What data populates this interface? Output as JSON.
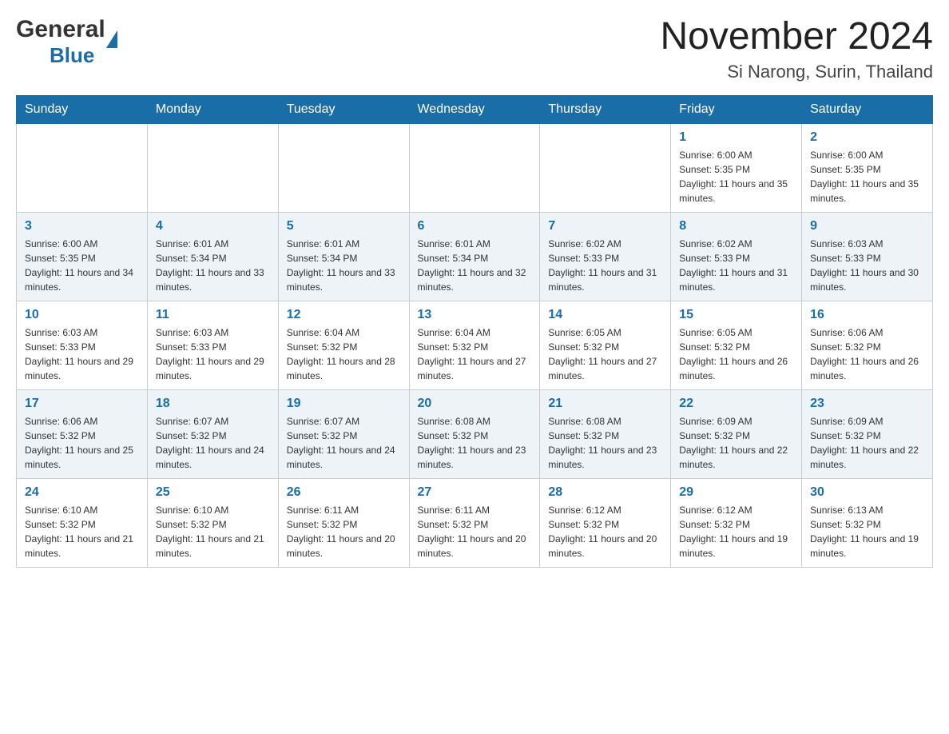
{
  "header": {
    "logo_line1": "General",
    "logo_line2": "Blue",
    "month_title": "November 2024",
    "location": "Si Narong, Surin, Thailand"
  },
  "days_of_week": [
    "Sunday",
    "Monday",
    "Tuesday",
    "Wednesday",
    "Thursday",
    "Friday",
    "Saturday"
  ],
  "weeks": [
    [
      {
        "day": "",
        "info": ""
      },
      {
        "day": "",
        "info": ""
      },
      {
        "day": "",
        "info": ""
      },
      {
        "day": "",
        "info": ""
      },
      {
        "day": "",
        "info": ""
      },
      {
        "day": "1",
        "info": "Sunrise: 6:00 AM\nSunset: 5:35 PM\nDaylight: 11 hours and 35 minutes."
      },
      {
        "day": "2",
        "info": "Sunrise: 6:00 AM\nSunset: 5:35 PM\nDaylight: 11 hours and 35 minutes."
      }
    ],
    [
      {
        "day": "3",
        "info": "Sunrise: 6:00 AM\nSunset: 5:35 PM\nDaylight: 11 hours and 34 minutes."
      },
      {
        "day": "4",
        "info": "Sunrise: 6:01 AM\nSunset: 5:34 PM\nDaylight: 11 hours and 33 minutes."
      },
      {
        "day": "5",
        "info": "Sunrise: 6:01 AM\nSunset: 5:34 PM\nDaylight: 11 hours and 33 minutes."
      },
      {
        "day": "6",
        "info": "Sunrise: 6:01 AM\nSunset: 5:34 PM\nDaylight: 11 hours and 32 minutes."
      },
      {
        "day": "7",
        "info": "Sunrise: 6:02 AM\nSunset: 5:33 PM\nDaylight: 11 hours and 31 minutes."
      },
      {
        "day": "8",
        "info": "Sunrise: 6:02 AM\nSunset: 5:33 PM\nDaylight: 11 hours and 31 minutes."
      },
      {
        "day": "9",
        "info": "Sunrise: 6:03 AM\nSunset: 5:33 PM\nDaylight: 11 hours and 30 minutes."
      }
    ],
    [
      {
        "day": "10",
        "info": "Sunrise: 6:03 AM\nSunset: 5:33 PM\nDaylight: 11 hours and 29 minutes."
      },
      {
        "day": "11",
        "info": "Sunrise: 6:03 AM\nSunset: 5:33 PM\nDaylight: 11 hours and 29 minutes."
      },
      {
        "day": "12",
        "info": "Sunrise: 6:04 AM\nSunset: 5:32 PM\nDaylight: 11 hours and 28 minutes."
      },
      {
        "day": "13",
        "info": "Sunrise: 6:04 AM\nSunset: 5:32 PM\nDaylight: 11 hours and 27 minutes."
      },
      {
        "day": "14",
        "info": "Sunrise: 6:05 AM\nSunset: 5:32 PM\nDaylight: 11 hours and 27 minutes."
      },
      {
        "day": "15",
        "info": "Sunrise: 6:05 AM\nSunset: 5:32 PM\nDaylight: 11 hours and 26 minutes."
      },
      {
        "day": "16",
        "info": "Sunrise: 6:06 AM\nSunset: 5:32 PM\nDaylight: 11 hours and 26 minutes."
      }
    ],
    [
      {
        "day": "17",
        "info": "Sunrise: 6:06 AM\nSunset: 5:32 PM\nDaylight: 11 hours and 25 minutes."
      },
      {
        "day": "18",
        "info": "Sunrise: 6:07 AM\nSunset: 5:32 PM\nDaylight: 11 hours and 24 minutes."
      },
      {
        "day": "19",
        "info": "Sunrise: 6:07 AM\nSunset: 5:32 PM\nDaylight: 11 hours and 24 minutes."
      },
      {
        "day": "20",
        "info": "Sunrise: 6:08 AM\nSunset: 5:32 PM\nDaylight: 11 hours and 23 minutes."
      },
      {
        "day": "21",
        "info": "Sunrise: 6:08 AM\nSunset: 5:32 PM\nDaylight: 11 hours and 23 minutes."
      },
      {
        "day": "22",
        "info": "Sunrise: 6:09 AM\nSunset: 5:32 PM\nDaylight: 11 hours and 22 minutes."
      },
      {
        "day": "23",
        "info": "Sunrise: 6:09 AM\nSunset: 5:32 PM\nDaylight: 11 hours and 22 minutes."
      }
    ],
    [
      {
        "day": "24",
        "info": "Sunrise: 6:10 AM\nSunset: 5:32 PM\nDaylight: 11 hours and 21 minutes."
      },
      {
        "day": "25",
        "info": "Sunrise: 6:10 AM\nSunset: 5:32 PM\nDaylight: 11 hours and 21 minutes."
      },
      {
        "day": "26",
        "info": "Sunrise: 6:11 AM\nSunset: 5:32 PM\nDaylight: 11 hours and 20 minutes."
      },
      {
        "day": "27",
        "info": "Sunrise: 6:11 AM\nSunset: 5:32 PM\nDaylight: 11 hours and 20 minutes."
      },
      {
        "day": "28",
        "info": "Sunrise: 6:12 AM\nSunset: 5:32 PM\nDaylight: 11 hours and 20 minutes."
      },
      {
        "day": "29",
        "info": "Sunrise: 6:12 AM\nSunset: 5:32 PM\nDaylight: 11 hours and 19 minutes."
      },
      {
        "day": "30",
        "info": "Sunrise: 6:13 AM\nSunset: 5:32 PM\nDaylight: 11 hours and 19 minutes."
      }
    ]
  ]
}
